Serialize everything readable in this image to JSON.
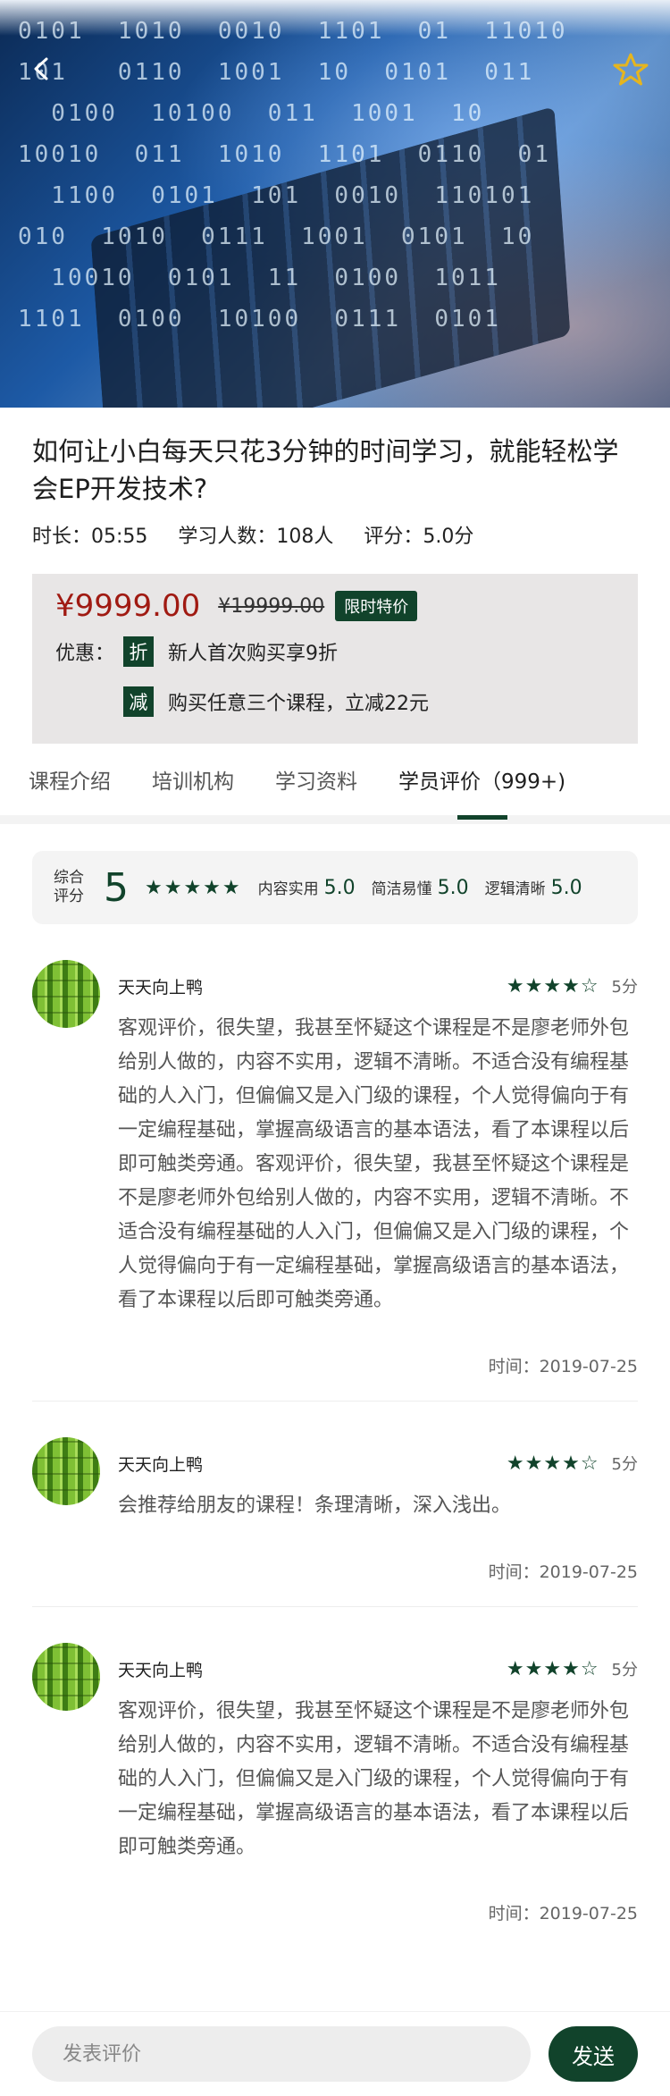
{
  "course": {
    "title": "如何让小白每天只花3分钟的时间学习，就能轻松学会EP开发技术?",
    "duration": "时长：05:55",
    "learners": "学习人数：108人",
    "rating": "评分：5.0分"
  },
  "price": {
    "current": "¥9999.00",
    "original": "¥19999.00",
    "badge": "限时特价",
    "promo_label": "优惠：",
    "promos": [
      {
        "tag": "折",
        "text": "新人首次购买享9折"
      },
      {
        "tag": "减",
        "text": "购买任意三个课程，立减22元"
      }
    ]
  },
  "tabs": [
    {
      "label": "课程介绍"
    },
    {
      "label": "培训机构"
    },
    {
      "label": "学习资料"
    },
    {
      "label": "学员评价（999+)"
    }
  ],
  "summary": {
    "label": "综合评分",
    "score": "5",
    "stars": "★★★★★",
    "items": [
      {
        "label": "内容实用",
        "value": "5.0"
      },
      {
        "label": "简洁易懂",
        "value": "5.0"
      },
      {
        "label": "逻辑清晰",
        "value": "5.0"
      }
    ]
  },
  "reviews": [
    {
      "name": "天天向上鸭",
      "stars": "★★★★☆",
      "score": "5分",
      "text": "客观评价，很失望，我甚至怀疑这个课程是不是廖老师外包给别人做的，内容不实用，逻辑不清晰。不适合没有编程基础的人入门，但偏偏又是入门级的课程，个人觉得偏向于有一定编程基础，掌握高级语言的基本语法，看了本课程以后即可触类旁通。客观评价，很失望，我甚至怀疑这个课程是不是廖老师外包给别人做的，内容不实用，逻辑不清晰。不适合没有编程基础的人入门，但偏偏又是入门级的课程，个人觉得偏向于有一定编程基础，掌握高级语言的基本语法，看了本课程以后即可触类旁通。",
      "time": "时间：2019-07-25"
    },
    {
      "name": "天天向上鸭",
      "stars": "★★★★☆",
      "score": "5分",
      "text": "会推荐给朋友的课程！条理清晰，深入浅出。",
      "time": "时间：2019-07-25"
    },
    {
      "name": "天天向上鸭",
      "stars": "★★★★☆",
      "score": "5分",
      "text": "客观评价，很失望，我甚至怀疑这个课程是不是廖老师外包给别人做的，内容不实用，逻辑不清晰。不适合没有编程基础的人入门，但偏偏又是入门级的课程，个人觉得偏向于有一定编程基础，掌握高级语言的基本语法，看了本课程以后即可触类旁通。",
      "time": "时间：2019-07-25"
    }
  ],
  "comment": {
    "placeholder": "发表评价",
    "send_label": "发送"
  },
  "icons": {
    "back": "chevron-left-icon",
    "favorite": "star-icon"
  },
  "colors": {
    "brand": "#11432b",
    "price": "#a01a12",
    "star": "#11432b",
    "favorite": "#e5b51f"
  }
}
